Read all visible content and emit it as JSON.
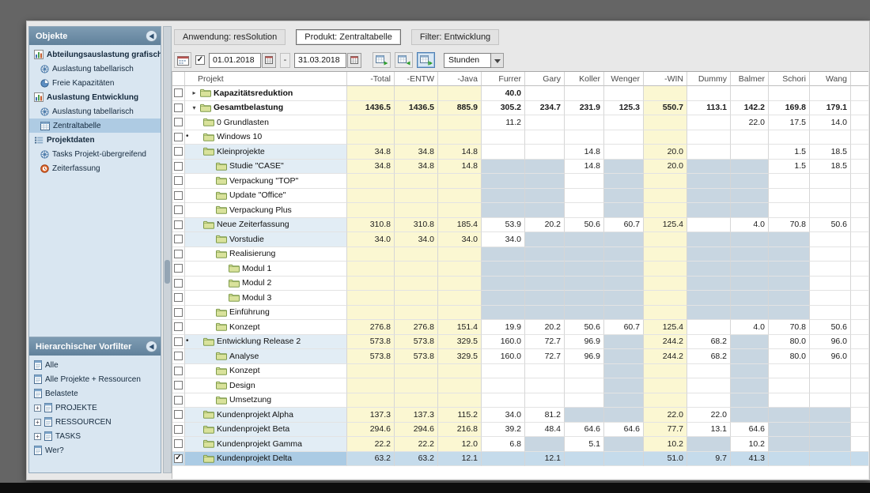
{
  "colors": {
    "panel_header": "#6d8ba4",
    "sidebar_bg": "#d9e6f1",
    "selected_item": "#aecbe3",
    "group_column": "#fbf7d2",
    "unavailable_cell": "#c8d6e1",
    "selected_row": "#c5dbeb",
    "selected_name": "#abcbe4",
    "name_tint": "#e2edf5"
  },
  "sidebar": {
    "panels": [
      {
        "title": "Objekte",
        "items": [
          {
            "label": "Abteilungsauslastung grafisch",
            "icon": "chart-icon",
            "bold": true,
            "indent": 0
          },
          {
            "label": "Auslastung tabellarisch",
            "icon": "wheel-icon",
            "indent": 1
          },
          {
            "label": "Freie Kapazitäten",
            "icon": "pie-icon",
            "indent": 1
          },
          {
            "label": "Auslastung Entwicklung",
            "icon": "chart-icon",
            "bold": true,
            "indent": 0
          },
          {
            "label": "Auslastung tabellarisch",
            "icon": "wheel-icon",
            "indent": 1
          },
          {
            "label": "Zentraltabelle",
            "icon": "grid-icon",
            "indent": 1,
            "selected": true
          },
          {
            "label": "Projektdaten",
            "icon": "list-icon",
            "bold": true,
            "indent": 0
          },
          {
            "label": "Tasks Projekt-übergreifend",
            "icon": "wheel-icon",
            "indent": 1
          },
          {
            "label": "Zeiterfassung",
            "icon": "clock-icon",
            "indent": 1
          }
        ]
      },
      {
        "title": "Hierarchischer Vorfilter",
        "items": [
          {
            "label": "Alle",
            "icon": "page-icon",
            "indent": 0
          },
          {
            "label": "Alle Projekte + Ressourcen",
            "icon": "page-icon",
            "indent": 0
          },
          {
            "label": "Belastete",
            "icon": "page-icon",
            "indent": 0
          },
          {
            "label": "PROJEKTE",
            "icon": "page-icon",
            "indent": 0,
            "expandable": true
          },
          {
            "label": "RESSOURCEN",
            "icon": "page-icon",
            "indent": 0,
            "expandable": true
          },
          {
            "label": "TASKS",
            "icon": "page-icon",
            "indent": 0,
            "expandable": true
          },
          {
            "label": "Wer?",
            "icon": "page-icon",
            "indent": 0
          }
        ]
      }
    ]
  },
  "toolbar": {
    "application": "Anwendung: resSolution",
    "product": "Produkt: Zentraltabelle",
    "filter": "Filter: Entwicklung",
    "date_from": "01.01.2018",
    "date_to": "31.03.2018",
    "range_separator": "-",
    "unit": "Stunden"
  },
  "table": {
    "project_header": "Projekt",
    "columns": [
      {
        "label": "-Total",
        "group": true
      },
      {
        "label": "-ENTW",
        "group": true
      },
      {
        "label": "-Java",
        "group": true
      },
      {
        "label": "Furrer"
      },
      {
        "label": "Gary"
      },
      {
        "label": "Koller"
      },
      {
        "label": "Wenger"
      },
      {
        "label": "-WIN",
        "group": true
      },
      {
        "label": "Dummy"
      },
      {
        "label": "Balmer"
      },
      {
        "label": "Schori"
      },
      {
        "label": "Wang"
      }
    ],
    "rows": [
      {
        "name": "Kapazitätsreduktion",
        "level": 0,
        "bold": true,
        "arrow": "▸",
        "vals": [
          "",
          "",
          "",
          "40.0",
          "",
          "",
          "",
          "",
          "",
          "",
          "",
          ""
        ],
        "bg": "yyywwwwywwww"
      },
      {
        "name": "Gesamtbelastung",
        "level": 0,
        "bold": true,
        "arrow": "▾",
        "vals": [
          "1436.5",
          "1436.5",
          "885.9",
          "305.2",
          "234.7",
          "231.9",
          "125.3",
          "550.7",
          "113.1",
          "142.2",
          "169.8",
          "179.1"
        ],
        "bg": "yyywwwwywwww"
      },
      {
        "name": "0 Grundlasten",
        "level": 1,
        "vals": [
          "",
          "",
          "",
          "11.2",
          "",
          "",
          "",
          "",
          "",
          "22.0",
          "17.5",
          "14.0"
        ],
        "bg": "yyywwwwywwww"
      },
      {
        "name": "Windows 10",
        "level": 1,
        "bullet": true,
        "vals": [
          "",
          "",
          "",
          "",
          "",
          "",
          "",
          "",
          "",
          "",
          "",
          ""
        ],
        "bg": "yyywwwwywwww"
      },
      {
        "name": "Kleinprojekte",
        "level": 1,
        "tint": true,
        "vals": [
          "34.8",
          "34.8",
          "14.8",
          "",
          "",
          "14.8",
          "",
          "20.0",
          "",
          "",
          "1.5",
          "18.5"
        ],
        "bg": "yyywwwwywwww"
      },
      {
        "name": "Studie \"CASE\"",
        "level": 2,
        "tint": true,
        "vals": [
          "34.8",
          "34.8",
          "14.8",
          "",
          "",
          "14.8",
          "",
          "20.0",
          "",
          "",
          "1.5",
          "18.5"
        ],
        "bg": "yyyggwgyggww"
      },
      {
        "name": "Verpackung \"TOP\"",
        "level": 2,
        "vals": [
          "",
          "",
          "",
          "",
          "",
          "",
          "",
          "",
          "",
          "",
          "",
          ""
        ],
        "bg": "yyyggwgyggww"
      },
      {
        "name": "Update \"Office\"",
        "level": 2,
        "vals": [
          "",
          "",
          "",
          "",
          "",
          "",
          "",
          "",
          "",
          "",
          "",
          ""
        ],
        "bg": "yyyggwgyggww"
      },
      {
        "name": "Verpackung Plus",
        "level": 2,
        "vals": [
          "",
          "",
          "",
          "",
          "",
          "",
          "",
          "",
          "",
          "",
          "",
          ""
        ],
        "bg": "yyyggwgyggww"
      },
      {
        "name": "Neue Zeiterfassung",
        "level": 1,
        "tint": true,
        "vals": [
          "310.8",
          "310.8",
          "185.4",
          "53.9",
          "20.2",
          "50.6",
          "60.7",
          "125.4",
          "",
          "4.0",
          "70.8",
          "50.6"
        ],
        "bg": "yyywwwwywwww"
      },
      {
        "name": "Vorstudie",
        "level": 2,
        "tint": true,
        "vals": [
          "34.0",
          "34.0",
          "34.0",
          "34.0",
          "",
          "",
          "",
          "",
          "",
          "",
          "",
          ""
        ],
        "bg": "yyywgggygggw"
      },
      {
        "name": "Realisierung",
        "level": 2,
        "vals": [
          "",
          "",
          "",
          "",
          "",
          "",
          "",
          "",
          "",
          "",
          "",
          ""
        ],
        "bg": "yyyggggygggw"
      },
      {
        "name": "Modul 1",
        "level": 3,
        "vals": [
          "",
          "",
          "",
          "",
          "",
          "",
          "",
          "",
          "",
          "",
          "",
          ""
        ],
        "bg": "yyyggggygggw"
      },
      {
        "name": "Modul 2",
        "level": 3,
        "vals": [
          "",
          "",
          "",
          "",
          "",
          "",
          "",
          "",
          "",
          "",
          "",
          ""
        ],
        "bg": "yyyggggygggw"
      },
      {
        "name": "Modul 3",
        "level": 3,
        "vals": [
          "",
          "",
          "",
          "",
          "",
          "",
          "",
          "",
          "",
          "",
          "",
          ""
        ],
        "bg": "yyyggggygggw"
      },
      {
        "name": "Einführung",
        "level": 2,
        "vals": [
          "",
          "",
          "",
          "",
          "",
          "",
          "",
          "",
          "",
          "",
          "",
          ""
        ],
        "bg": "yyyggggygggw"
      },
      {
        "name": "Konzept",
        "level": 2,
        "vals": [
          "276.8",
          "276.8",
          "151.4",
          "19.9",
          "20.2",
          "50.6",
          "60.7",
          "125.4",
          "",
          "4.0",
          "70.8",
          "50.6"
        ],
        "bg": "yyywwwwywwww"
      },
      {
        "name": "Entwicklung Release 2",
        "level": 1,
        "bullet": true,
        "tint": true,
        "vals": [
          "573.8",
          "573.8",
          "329.5",
          "160.0",
          "72.7",
          "96.9",
          "",
          "244.2",
          "68.2",
          "",
          "80.0",
          "96.0"
        ],
        "bg": "yyywwwgywgww"
      },
      {
        "name": "Analyse",
        "level": 2,
        "tint": true,
        "vals": [
          "573.8",
          "573.8",
          "329.5",
          "160.0",
          "72.7",
          "96.9",
          "",
          "244.2",
          "68.2",
          "",
          "80.0",
          "96.0"
        ],
        "bg": "yyywwwgywgww"
      },
      {
        "name": "Konzept",
        "level": 2,
        "vals": [
          "",
          "",
          "",
          "",
          "",
          "",
          "",
          "",
          "",
          "",
          "",
          ""
        ],
        "bg": "yyywwwgywgww"
      },
      {
        "name": "Design",
        "level": 2,
        "vals": [
          "",
          "",
          "",
          "",
          "",
          "",
          "",
          "",
          "",
          "",
          "",
          ""
        ],
        "bg": "yyywwwgywgww"
      },
      {
        "name": "Umsetzung",
        "level": 2,
        "vals": [
          "",
          "",
          "",
          "",
          "",
          "",
          "",
          "",
          "",
          "",
          "",
          ""
        ],
        "bg": "yyywwwgywgww"
      },
      {
        "name": "Kundenprojekt Alpha",
        "level": 1,
        "tint": true,
        "vals": [
          "137.3",
          "137.3",
          "115.2",
          "34.0",
          "81.2",
          "",
          "",
          "22.0",
          "22.0",
          "",
          "",
          ""
        ],
        "bg": "yyywwggywggg"
      },
      {
        "name": "Kundenprojekt Beta",
        "level": 1,
        "tint": true,
        "vals": [
          "294.6",
          "294.6",
          "216.8",
          "39.2",
          "48.4",
          "64.6",
          "64.6",
          "77.7",
          "13.1",
          "64.6",
          "",
          ""
        ],
        "bg": "yyywwwwywwgg"
      },
      {
        "name": "Kundenprojekt Gamma",
        "level": 1,
        "tint": true,
        "vals": [
          "22.2",
          "22.2",
          "12.0",
          "6.8",
          "",
          "5.1",
          "",
          "10.2",
          "",
          "10.2",
          "",
          ""
        ],
        "bg": "yyywgwgygwgg"
      },
      {
        "name": "Kundenprojekt Delta",
        "level": 1,
        "selected": true,
        "checked": true,
        "vals": [
          "63.2",
          "63.2",
          "12.1",
          "",
          "12.1",
          "",
          "",
          "51.0",
          "9.7",
          "41.3",
          "",
          ""
        ],
        "bg": "bbbbbbbbbbbb"
      }
    ]
  }
}
